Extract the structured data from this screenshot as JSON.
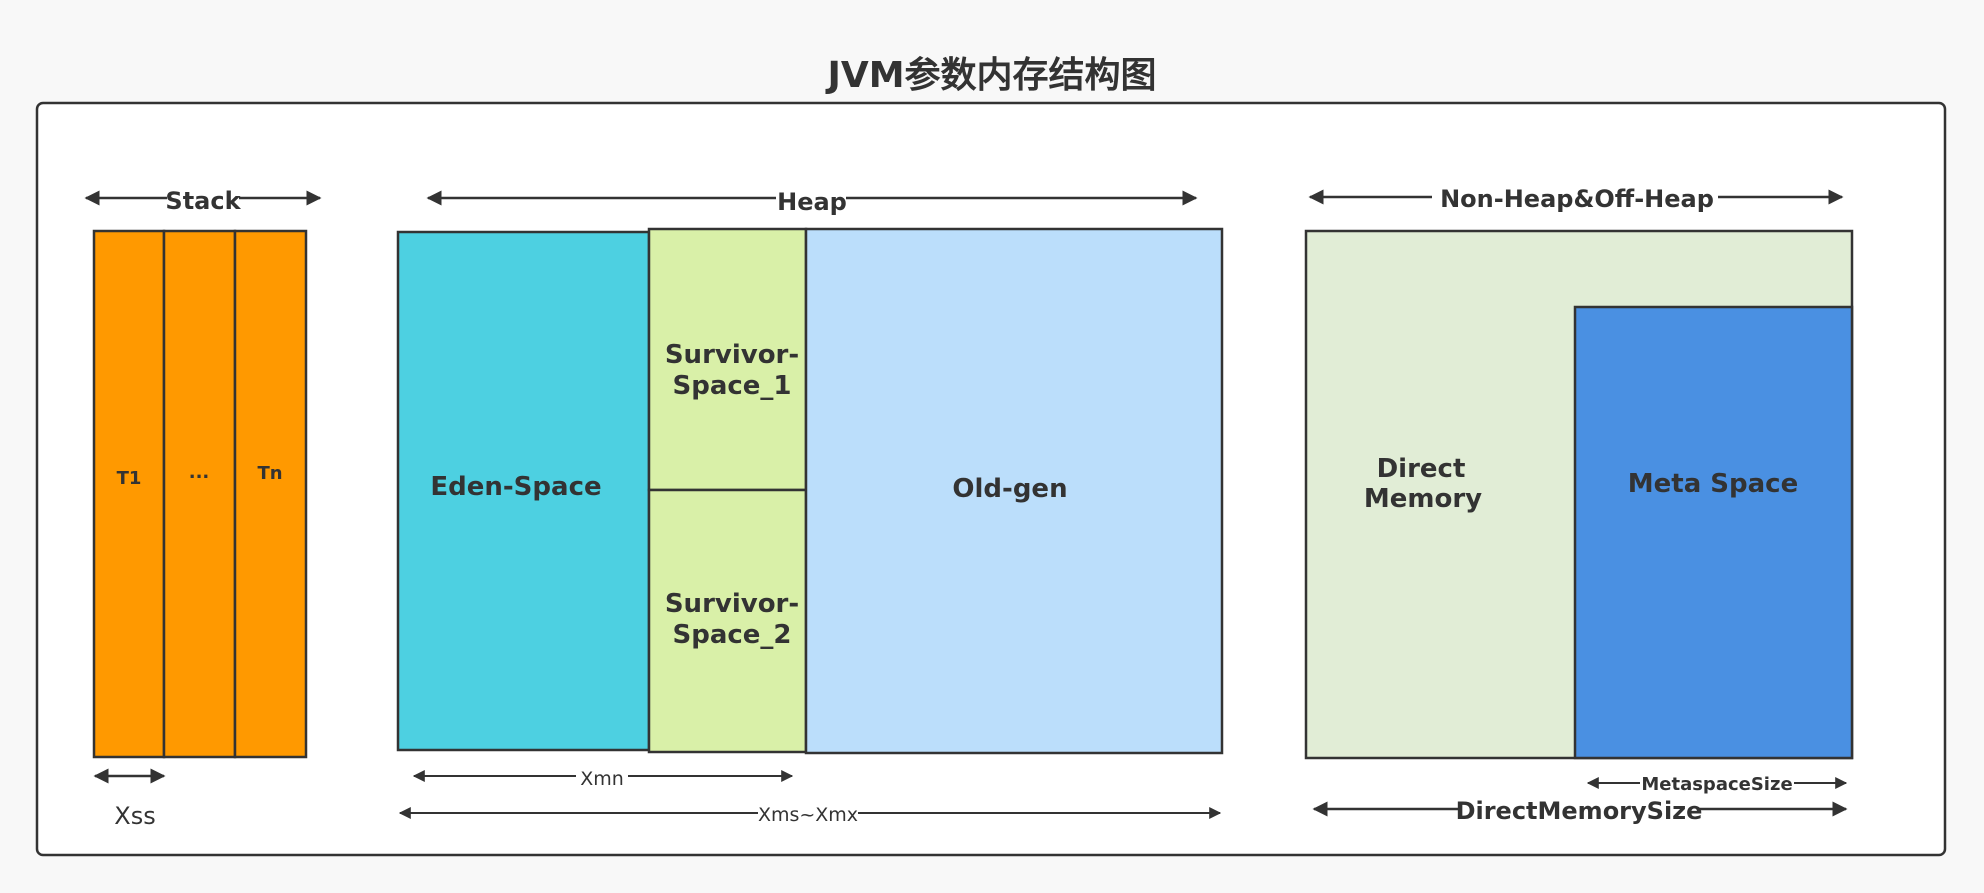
{
  "title": "JVM参数内存结构图",
  "stack": {
    "label": "Stack",
    "threads": [
      "T1",
      "...",
      "Tn"
    ],
    "param": "Xss",
    "color": "#ff9900"
  },
  "heap": {
    "label": "Heap",
    "eden": "Eden-Space",
    "survivor1": [
      "Survivor-",
      "Space_1"
    ],
    "survivor2": [
      "Survivor-",
      "Space_2"
    ],
    "old": "Old-gen",
    "young_param": "Xmn",
    "heap_param": "Xms~Xmx",
    "colors": {
      "eden": "#4dd0e1",
      "survivor": "#d9f0a8",
      "old": "#bbdefb"
    }
  },
  "nonheap": {
    "label": "Non-Heap&Off-Heap",
    "direct": [
      "Direct",
      "Memory"
    ],
    "meta": "Meta Space",
    "meta_param": "MetaspaceSize",
    "direct_param": "DirectMemorySize",
    "colors": {
      "direct": "#e1edd6",
      "meta": "#4a90e2"
    }
  }
}
